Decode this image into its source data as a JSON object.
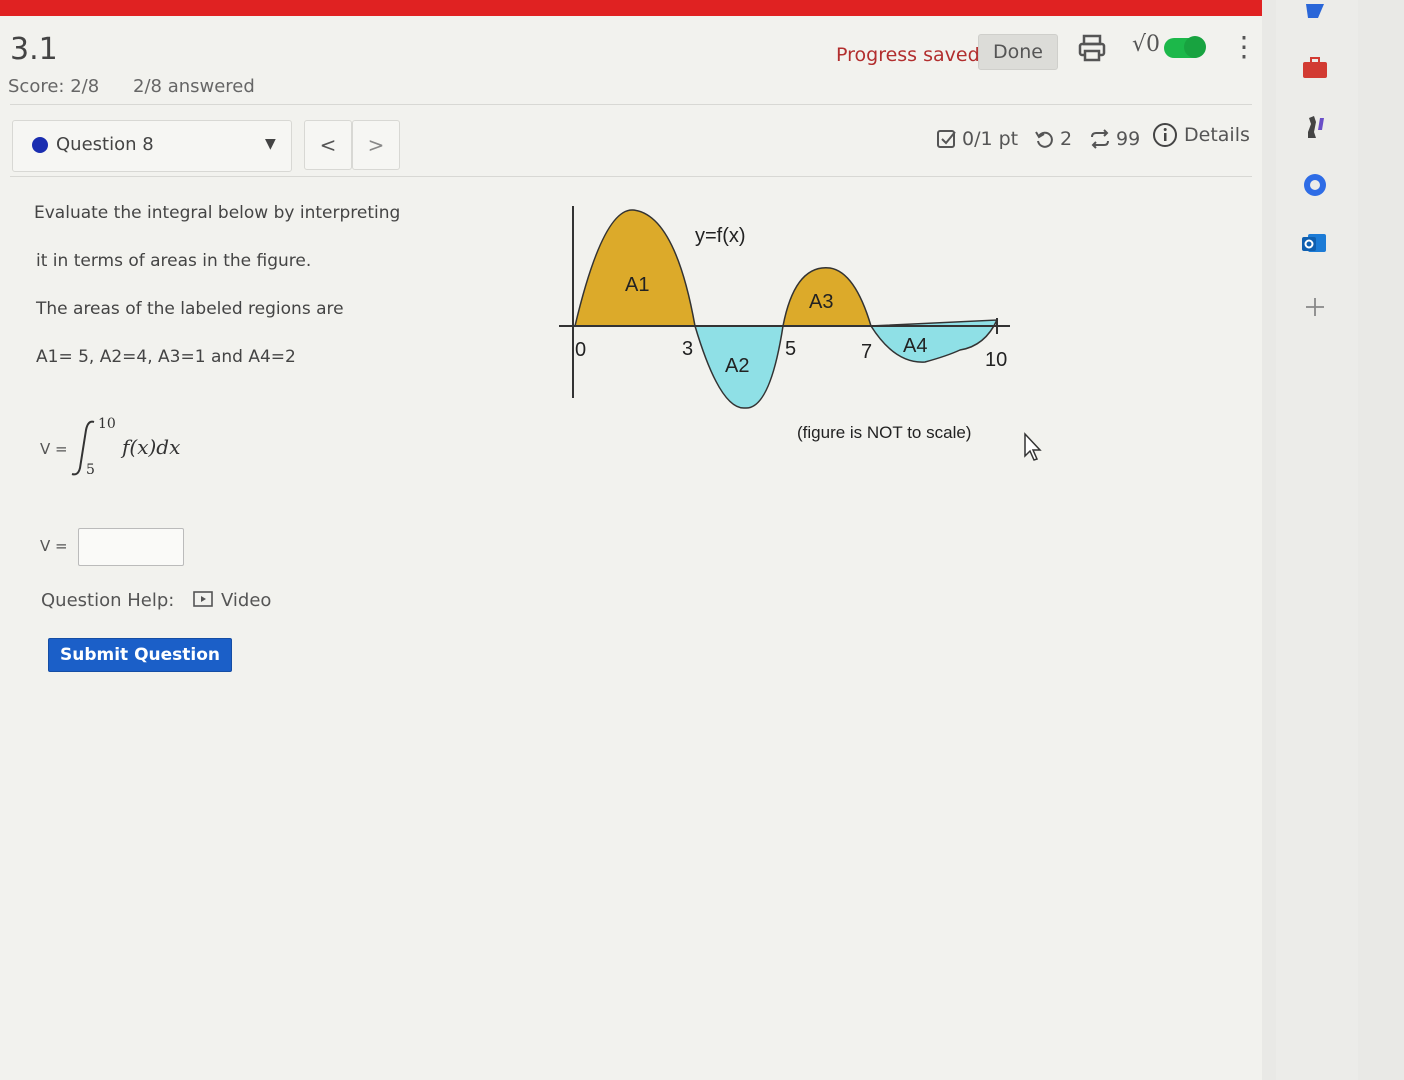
{
  "header": {
    "title": "3.1",
    "score": "Score: 2/8",
    "answered": "2/8 answered",
    "progress": "Progress saved",
    "done": "Done",
    "sqrt_label": "√0"
  },
  "question_nav": {
    "label": "Question 8",
    "prev": "<",
    "next": ">",
    "points": "0/1 pt",
    "retries": "2",
    "attempts": "99",
    "details": "Details"
  },
  "question": {
    "line1": "Evaluate the integral below by interpreting",
    "line2": "it in terms of areas in the figure.",
    "line3": "The areas of the labeled regions are",
    "line4": "A1= 5, A2=4, A3=1 and A4=2",
    "integral_prefix": "V =",
    "integral_upper": "10",
    "integral_lower": "5",
    "integrand": "f(x)dx",
    "answer_label": "V =",
    "answer_value": "",
    "help_label": "Question Help:",
    "video_label": "Video",
    "submit": "Submit Question"
  },
  "figure": {
    "curve_label": "y=f(x)",
    "regions": [
      "A1",
      "A2",
      "A3",
      "A4"
    ],
    "x_ticks": [
      "0",
      "3",
      "5",
      "7",
      "10"
    ],
    "note": "(figure is NOT to scale)",
    "colors": {
      "positive": "#dcaa2a",
      "negative": "#8fe0e6"
    }
  }
}
